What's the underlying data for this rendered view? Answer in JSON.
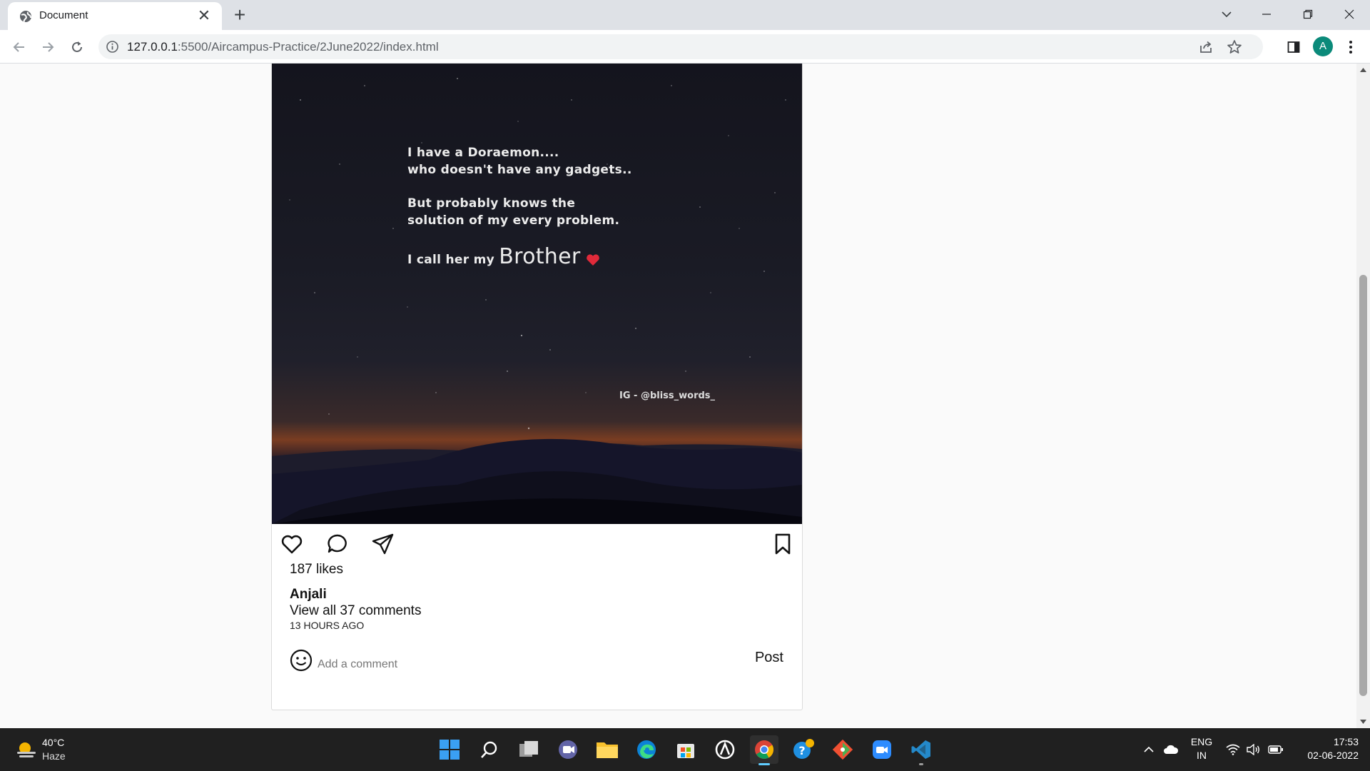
{
  "browser": {
    "tab_title": "Document",
    "new_tab_symbol": "+",
    "close_symbol": "✕",
    "url_host": "127.0.0.1",
    "url_path": ":5500/Aircampus-Practice/2June2022/index.html",
    "profile_initial": "A"
  },
  "post": {
    "image": {
      "quote_line_1": "I have a Doraemon....",
      "quote_line_2": "who doesn't have any gadgets..",
      "quote_line_3": "But probably knows the",
      "quote_line_4": "solution of my every problem.",
      "quote_line_5_prefix": "I call her my",
      "quote_line_5_emphasis": "Brother",
      "credit": "IG - @bliss_words_"
    },
    "likes": "187 likes",
    "author": "Anjali",
    "view_comments": "View all 37 comments",
    "timestamp": "13 HOURS AGO",
    "comment_placeholder": "Add a comment",
    "post_button": "Post"
  },
  "taskbar": {
    "weather_temp": "40°C",
    "weather_condition": "Haze",
    "language": "ENG",
    "region": "IN",
    "time": "17:53",
    "date": "02-06-2022",
    "apps": [
      "start-icon",
      "search-icon",
      "task-view-icon",
      "chat-icon",
      "file-explorer-icon",
      "edge-icon",
      "store-icon",
      "app-icon",
      "chrome-icon",
      "help-icon",
      "git-icon",
      "zoom-icon",
      "vscode-icon"
    ]
  },
  "colors": {
    "accent": "#0b8a7a",
    "taskbar_bg": "#202020",
    "heart": "#e02a3a"
  }
}
